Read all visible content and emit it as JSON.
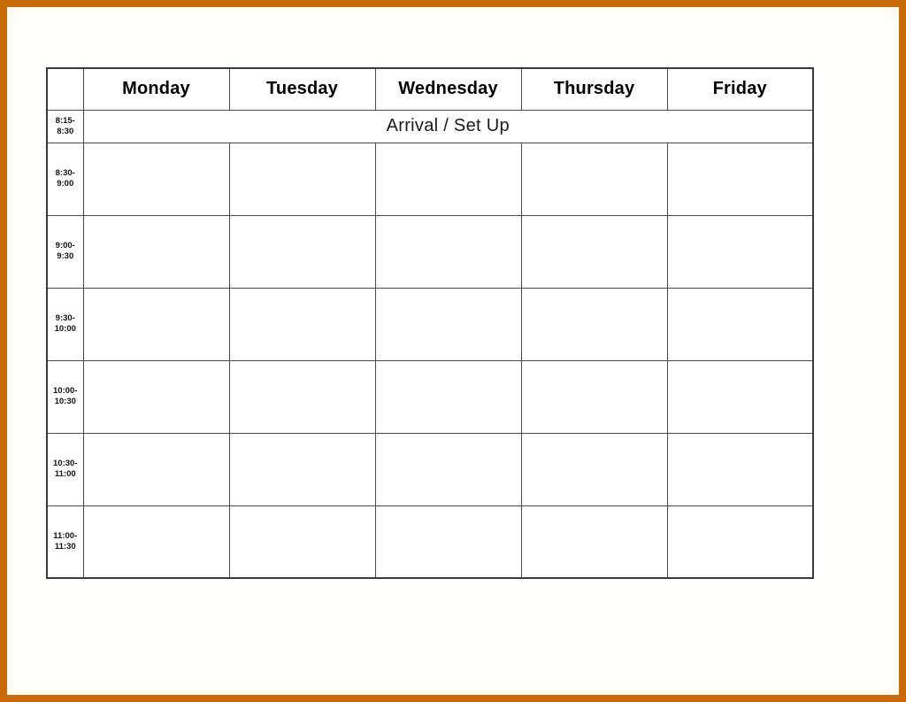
{
  "document": {
    "type": "weekly-class-schedule-template",
    "frame_color": "#c96a09",
    "page_background": "#fffffd",
    "grid_line_color": "#4a4a4a"
  },
  "table": {
    "corner_header": "",
    "day_headers": [
      "Monday",
      "Tuesday",
      "Wednesday",
      "Thursday",
      "Friday"
    ],
    "arrival_row": {
      "time_line1": "8:15-",
      "time_line2": "8:30",
      "label": "Arrival / Set Up"
    },
    "rows": [
      {
        "time_line1": "8:30-",
        "time_line2": "9:00",
        "cells": [
          "",
          "",
          "",
          "",
          ""
        ]
      },
      {
        "time_line1": "9:00-",
        "time_line2": "9:30",
        "cells": [
          "",
          "",
          "",
          "",
          ""
        ]
      },
      {
        "time_line1": "9:30-",
        "time_line2": "10:00",
        "cells": [
          "",
          "",
          "",
          "",
          ""
        ]
      },
      {
        "time_line1": "10:00-",
        "time_line2": "10:30",
        "cells": [
          "",
          "",
          "",
          "",
          ""
        ]
      },
      {
        "time_line1": "10:30-",
        "time_line2": "11:00",
        "cells": [
          "",
          "",
          "",
          "",
          ""
        ]
      },
      {
        "time_line1": "11:00-",
        "time_line2": "11:30",
        "cells": [
          "",
          "",
          "",
          "",
          ""
        ]
      }
    ]
  }
}
